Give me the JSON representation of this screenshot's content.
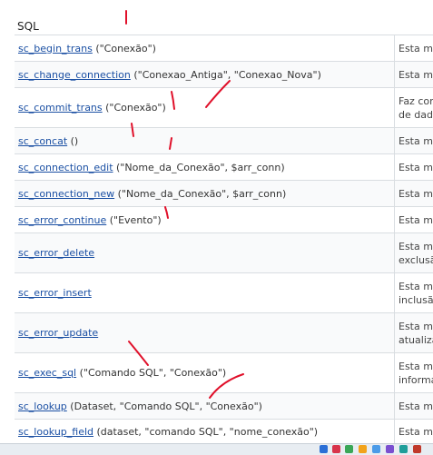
{
  "section": {
    "title": "SQL"
  },
  "rows": [
    {
      "fn": "sc_begin_trans",
      "args": "(\"Conexão\")",
      "desc": "Esta mac"
    },
    {
      "fn": "sc_change_connection",
      "args": "(\"Conexao_Antiga\", \"Conexao_Nova\")",
      "desc": "Esta mac"
    },
    {
      "fn": "sc_commit_trans",
      "args": "(\"Conexão\")",
      "desc": "Faz com de dado"
    },
    {
      "fn": "sc_concat",
      "args": "()",
      "desc": "Esta mac"
    },
    {
      "fn": "sc_connection_edit",
      "args": "(\"Nome_da_Conexão\", $arr_conn)",
      "desc": "Esta mac"
    },
    {
      "fn": "sc_connection_new",
      "args": "(\"Nome_da_Conexão\", $arr_conn)",
      "desc": "Esta mac"
    },
    {
      "fn": "sc_error_continue",
      "args": "(\"Evento\")",
      "desc": "Esta mac"
    },
    {
      "fn": "sc_error_delete",
      "args": "",
      "desc": "Esta ma exclusão"
    },
    {
      "fn": "sc_error_insert",
      "args": "",
      "desc": "Esta ma inclusão"
    },
    {
      "fn": "sc_error_update",
      "args": "",
      "desc": "Esta ma atualiza"
    },
    {
      "fn": "sc_exec_sql",
      "args": "(\"Comando SQL\", \"Conexão\")",
      "desc": "Esta ma informac"
    },
    {
      "fn": "sc_lookup",
      "args": "(Dataset, \"Comando SQL\", \"Conexão\")",
      "desc": "Esta mac"
    },
    {
      "fn": "sc_lookup_field",
      "args": "(dataset, \"comando SQL\", \"nome_conexão\")",
      "desc": "Esta ma"
    }
  ],
  "colors": {
    "link": "#1a4fa3",
    "annotation": "#e0102a",
    "border": "#d9dde1"
  }
}
